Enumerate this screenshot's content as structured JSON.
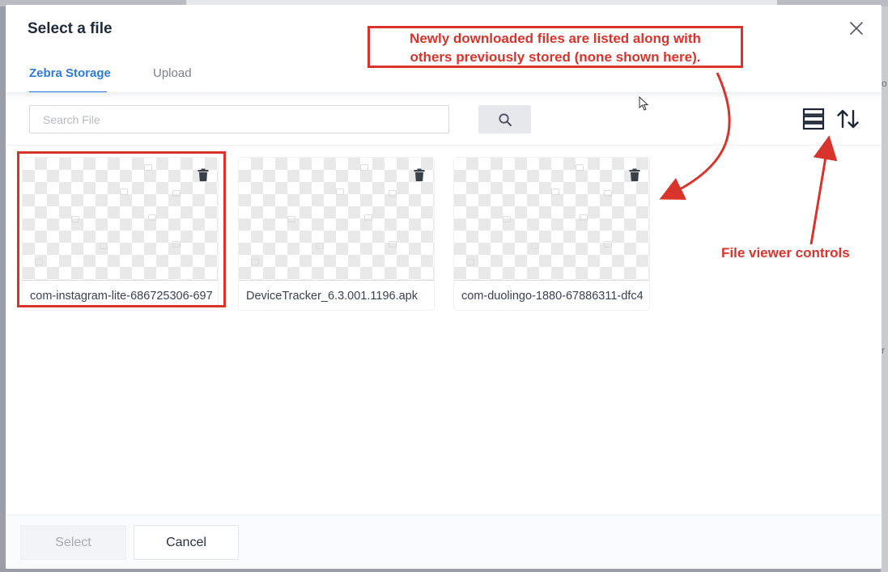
{
  "dialog": {
    "title": "Select a file",
    "close_icon": "close-icon"
  },
  "tabs": [
    {
      "label": "Zebra Storage",
      "active": true
    },
    {
      "label": "Upload",
      "active": false
    }
  ],
  "search": {
    "placeholder": "Search File",
    "value": "",
    "button_icon": "search-icon"
  },
  "toolbar": {
    "view_icon": "list-view-icon",
    "sort_icon": "sort-icon"
  },
  "files": [
    {
      "name": "com-instagram-lite-686725306-697",
      "selected": true
    },
    {
      "name": "DeviceTracker_6.3.001.1196.apk",
      "selected": false
    },
    {
      "name": "com-duolingo-1880-67886311-dfc4",
      "selected": false
    }
  ],
  "footer": {
    "select_label": "Select",
    "cancel_label": "Cancel"
  },
  "annotations": {
    "callout_line1": "Newly downloaded files are listed along with",
    "callout_line2": "others previously stored (none shown here).",
    "controls_label": "File viewer controls",
    "color": "#d9342b"
  },
  "colors": {
    "accent": "#2f7bd6",
    "annotation": "#d9342b"
  }
}
